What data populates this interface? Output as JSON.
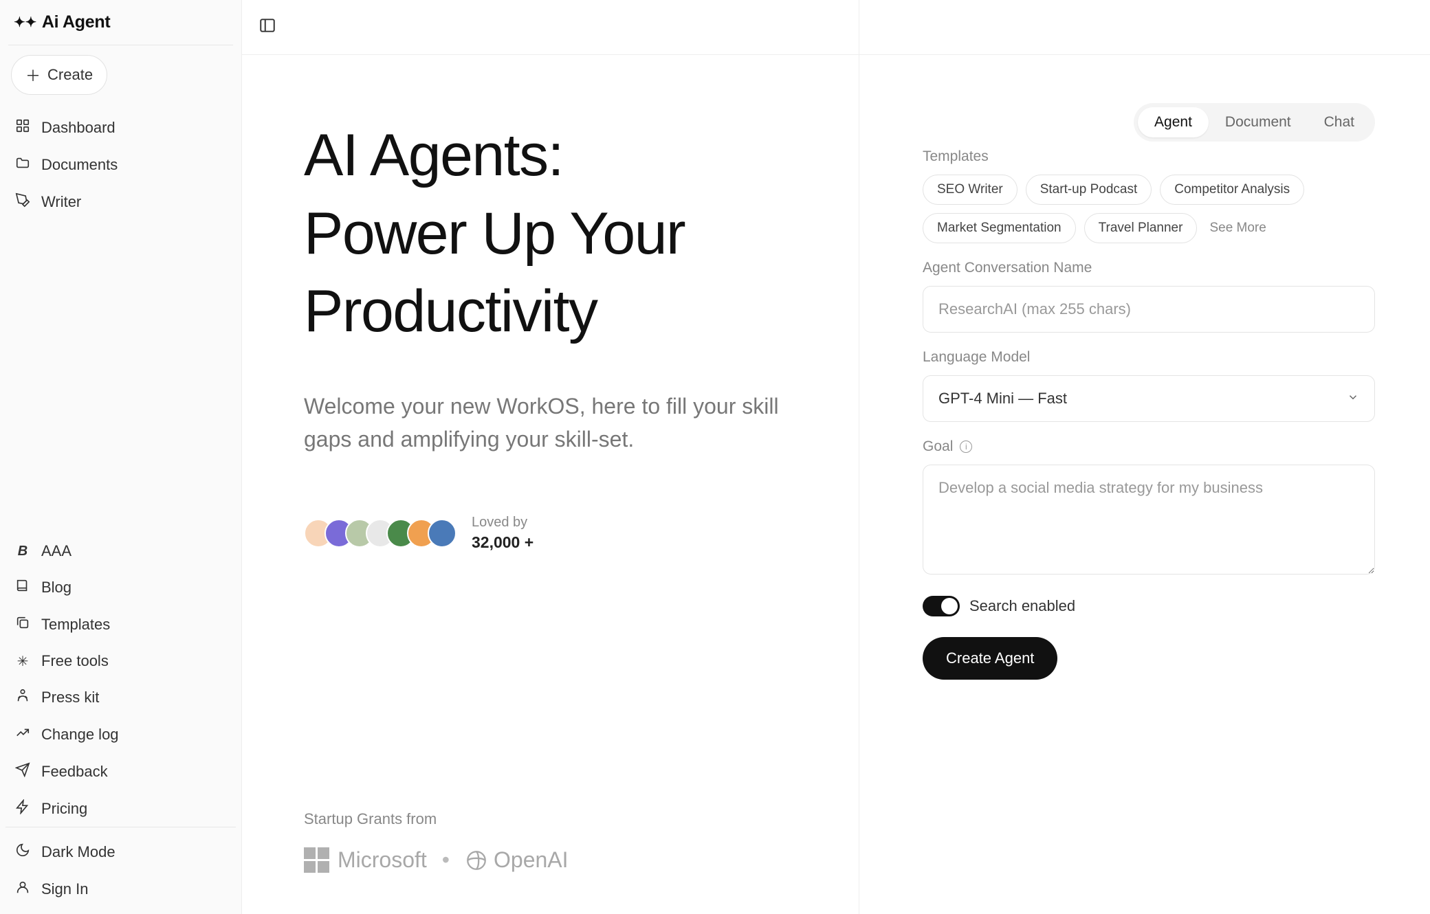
{
  "brand": {
    "name": "Ai Agent"
  },
  "sidebar": {
    "create_label": "Create",
    "nav": [
      {
        "label": "Dashboard"
      },
      {
        "label": "Documents"
      },
      {
        "label": "Writer"
      }
    ],
    "secondary": [
      {
        "label": "AAA"
      },
      {
        "label": "Blog"
      },
      {
        "label": "Templates"
      },
      {
        "label": "Free tools"
      },
      {
        "label": "Press kit"
      },
      {
        "label": "Change log"
      },
      {
        "label": "Feedback"
      },
      {
        "label": "Pricing"
      }
    ],
    "footer": [
      {
        "label": "Dark Mode"
      },
      {
        "label": "Sign In"
      }
    ]
  },
  "hero": {
    "headline_line1": "AI Agents:",
    "headline_line2": "Power Up Your",
    "headline_line3": "Productivity",
    "subhead": "Welcome your new WorkOS, here to fill your skill gaps and amplifying your skill-set.",
    "loved_label": "Loved by",
    "loved_count": "32,000 +",
    "grants_label": "Startup Grants from",
    "grants": {
      "microsoft": "Microsoft",
      "openai": "OpenAI"
    }
  },
  "form": {
    "tabs": [
      {
        "label": "Agent",
        "active": true
      },
      {
        "label": "Document",
        "active": false
      },
      {
        "label": "Chat",
        "active": false
      }
    ],
    "templates_label": "Templates",
    "templates": [
      "SEO Writer",
      "Start-up Podcast",
      "Competitor Analysis",
      "Market Segmentation",
      "Travel Planner"
    ],
    "see_more": "See More",
    "name_label": "Agent Conversation Name",
    "name_placeholder": "ResearchAI (max 255 chars)",
    "model_label": "Language Model",
    "model_value": "GPT-4 Mini — Fast",
    "goal_label": "Goal",
    "goal_placeholder": "Develop a social media strategy for my business",
    "search_toggle_label": "Search enabled",
    "search_toggle_on": true,
    "submit_label": "Create Agent"
  },
  "avatar_colors": [
    "#f8d5b8",
    "#7a6bd8",
    "#b8c9a8",
    "#e8e8e8",
    "#4a8a4a",
    "#f0a050",
    "#4a7ab8"
  ]
}
